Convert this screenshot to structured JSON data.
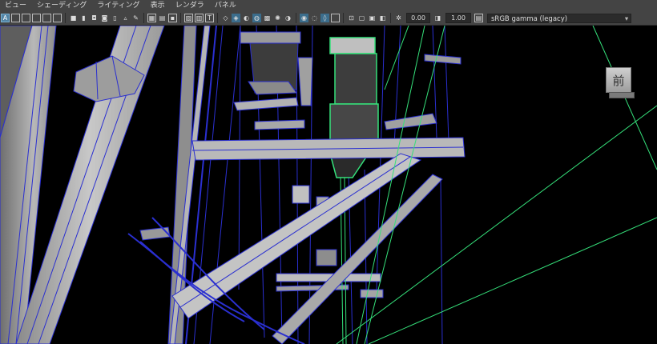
{
  "menu": [
    "ビュー",
    "シェーディング",
    "ライティング",
    "表示",
    "レンダラ",
    "パネル"
  ],
  "toolbar": {
    "exposure_value": "0.00",
    "gamma_value": "1.00",
    "color_space": "sRGB gamma (legacy)"
  },
  "viewcube": {
    "label": "前"
  },
  "colors": {
    "wire_blue": "#2a2fd0",
    "wire_green": "#35e07a",
    "mesh_gray": "#a7a7a7"
  }
}
